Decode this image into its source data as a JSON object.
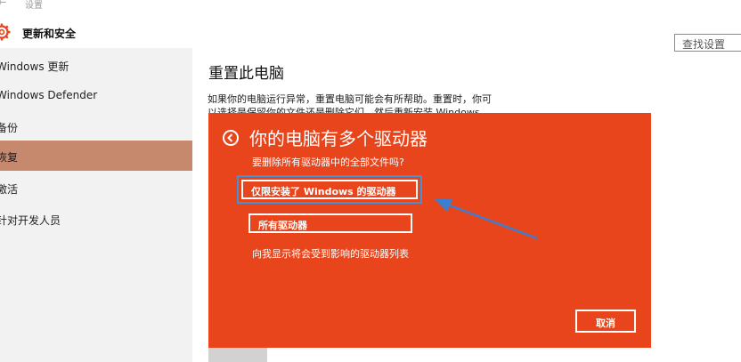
{
  "window": {
    "title": "设置"
  },
  "header": {
    "title": "更新和安全",
    "search_placeholder": "查找设置"
  },
  "sidebar": {
    "items": [
      {
        "label": "Windows 更新"
      },
      {
        "label": "Windows Defender"
      },
      {
        "label": "备份"
      },
      {
        "label": "恢复"
      },
      {
        "label": "激活"
      },
      {
        "label": "针对开发人员"
      }
    ]
  },
  "main": {
    "heading": "重置此电脑",
    "description_line1": "如果你的电脑运行异常，重置电脑可能会有所帮助。重置时，你可",
    "description_line2": "以选择是保留你的文件还是删除它们，然后重新安装 Windows。"
  },
  "dialog": {
    "title": "你的电脑有多个驱动器",
    "question": "要删除所有驱动器中的全部文件吗?",
    "option1": "仅限安装了 Windows 的驱动器",
    "option2": "所有驱动器",
    "link": "向我显示将会受到影响的驱动器列表",
    "cancel": "取消"
  },
  "colors": {
    "dialog_bg": "#e8451c",
    "sidebar_active": "#c7896e",
    "highlight": "#4a8fd4"
  }
}
